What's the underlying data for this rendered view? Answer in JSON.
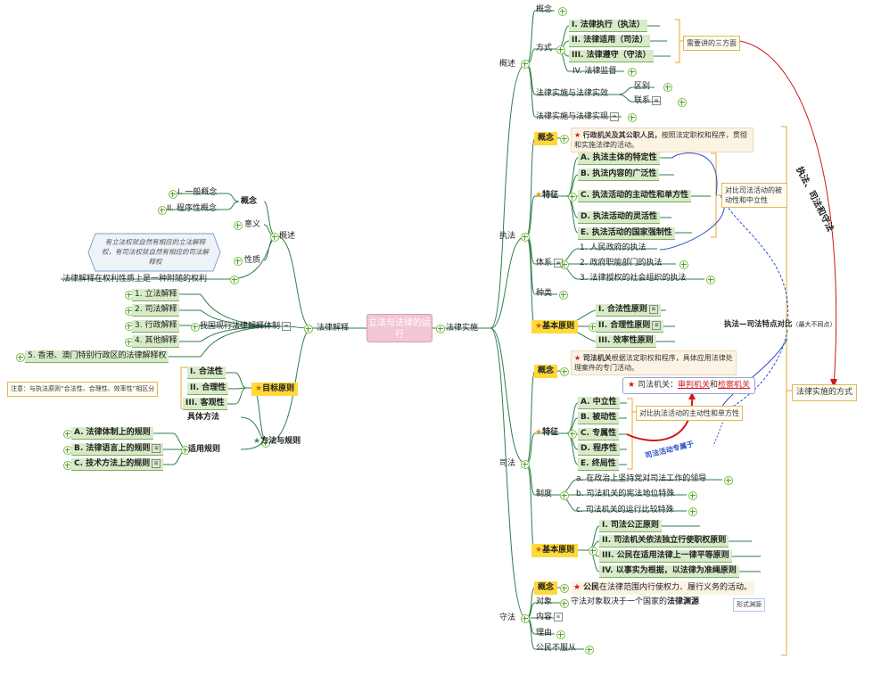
{
  "center": "立法与法律的运行",
  "colors": {
    "line": "#2f7d4f",
    "highlight": "#d7ebc8",
    "tag": "#ffd93a",
    "red": "#d01818",
    "blue": "#2a50c8"
  },
  "left": {
    "interpret": "法律解释",
    "overview": "概述",
    "concept": "概念",
    "general_concept": "I. 一般概念",
    "procedural_concept": "II. 程序性概念",
    "meaning": "意义",
    "nature": "性质",
    "hex_note": "有立法权就自然有相应的立法解释权，有司法权就自然有相应的司法解释权",
    "nature_note": "法律解释在权利性质上是一种附随的权利",
    "system": "我国现行法律解释体制",
    "system_items": [
      "1. 立法解释",
      "2. 司法解释",
      "3. 行政解释",
      "4. 其他解释",
      "5. 香港、澳门特别行政区的法律解释权"
    ],
    "method": "方法与规则",
    "goal": "目标原则",
    "goal_items": [
      "I. 合法性",
      "II. 合理性",
      "III. 客观性"
    ],
    "goal_note": "注意：与执法原则“合法性、合理性、效率性”相区分",
    "specific_method": "具体方法",
    "applied_rules": "适用规则",
    "rules": [
      "A. 法律体制上的规则",
      "B. 法律语言上的规则",
      "C. 技术方法上的规则"
    ]
  },
  "right": {
    "implement": "法律实施",
    "overview": "概述",
    "concept": "概念",
    "mode": "方式",
    "modes": [
      "I. 法律执行（执法）",
      "II. 法律适用（司法）",
      "III. 法律遵守（守法）",
      "IV. 法律监督"
    ],
    "three_note": "需要讲的三方面",
    "impl_effect": "法律实施与法律实效",
    "diff": "区别",
    "relation": "联系",
    "impl_realize": "法律实施与法律实现",
    "exec": "执法",
    "exec_concept_tag": "概念",
    "exec_concept_bold": "行政机关及其公职人员，",
    "exec_concept_rest": "按照法定职权和程序，贯彻和实施法律的活动。",
    "feature": "特征",
    "exec_features": [
      "A. 执法主体的特定性",
      "B. 执法内容的广泛性",
      "C. 执法活动的主动性和单方性",
      "D. 执法活动的灵活性",
      "E. 执法活动的国家强制性"
    ],
    "exec_compare_note": "对比司法活动的被动性和中立性",
    "system": "体系",
    "exec_system": [
      "1. 人民政府的执法",
      "2. 政府职能部门的执法",
      "3. 法律授权的社会组织的执法"
    ],
    "types": "种类",
    "basic_principle": "基本原则",
    "exec_principles": [
      "I. 合法性原则",
      "II. 合理性原则",
      "III. 效率性原则"
    ],
    "judicial": "司法",
    "jud_concept_bold": "司法机关",
    "jud_concept_rest": "根据法定职权和程序，具体应用法律处理案件的专门活动。",
    "jud_organs_label": "司法机关：",
    "jud_organs_a": "审判机关",
    "jud_organs_and": "和",
    "jud_organs_b": "检察机关",
    "jud_features": [
      "A. 中立性",
      "B. 被动性",
      "C. 专属性",
      "D. 程序性",
      "E. 终局性"
    ],
    "jud_compare_note": "对比执法活动的主动性和单方性",
    "jud_exclusive": "司法活动专属于",
    "institution": "制度",
    "jud_institution": [
      "a. 在政治上坚持党对司法工作的领导",
      "b. 司法机关的宪法地位特殊",
      "c. 司法机关的运行比较特殊"
    ],
    "jud_principles": [
      "I. 司法公正原则",
      "II. 司法机关依法独立行使职权原则",
      "III. 公民在适用法律上一律平等原则",
      "IV. 以事实为根据，以法律为准绳原则"
    ],
    "obey": "守法",
    "obey_concept_bold": "公民",
    "obey_concept_rest": "在法律范围内行使权力、履行义务的活动。",
    "object": "对象",
    "object_note_a": "守法对象取决于一个国家的",
    "object_note_b": "法律渊源",
    "form_source": "形式渊源",
    "content": "内容",
    "reason": "理由",
    "disobey": "公民不服从",
    "compare_title": "执法—司法特点对比",
    "compare_sub": "（最大不同点）",
    "diagonal": "执法、司法和守法",
    "impl_mode_note": "法律实施的方式"
  }
}
